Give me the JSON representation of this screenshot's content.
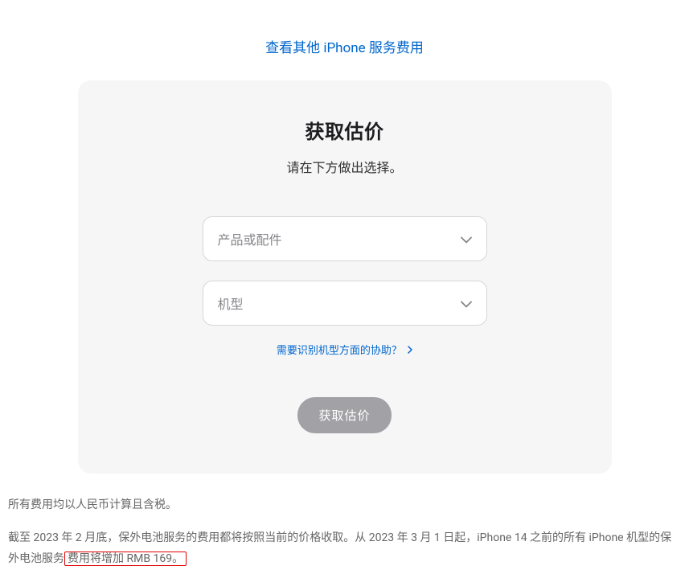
{
  "topLink": {
    "label": "查看其他 iPhone 服务费用"
  },
  "card": {
    "title": "获取估价",
    "subtitle": "请在下方做出选择。",
    "select1": {
      "placeholder": "产品或配件"
    },
    "select2": {
      "placeholder": "机型"
    },
    "helpLink": {
      "label": "需要识别机型方面的协助？"
    },
    "submitButton": {
      "label": "获取估价"
    }
  },
  "footer": {
    "line1": "所有费用均以人民币计算且含税。",
    "line2_part1": "截至 2023 年 2 月底，保外电池服务的费用都将按照当前的价格收取。从 2023 年 3 月 1 日起，iPhone 14 之前的所有 iPhone 机型的保外电池服务",
    "line2_highlight": "费用将增加 RMB 169。"
  }
}
